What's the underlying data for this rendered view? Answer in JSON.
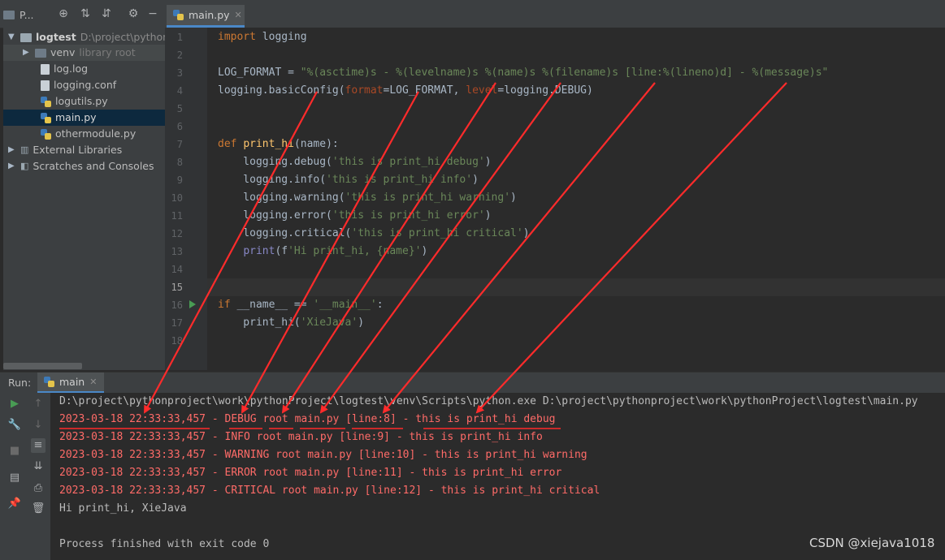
{
  "toolbar": {
    "project_tab_label": "P...",
    "editor_tab_label": "main.py"
  },
  "project": {
    "root_label": "logtest",
    "root_path": "D:\\project\\pythonp",
    "items": [
      {
        "label": "venv",
        "suffix": "library root"
      },
      {
        "label": "log.log"
      },
      {
        "label": "logging.conf"
      },
      {
        "label": "logutils.py"
      },
      {
        "label": "main.py"
      },
      {
        "label": "othermodule.py"
      },
      {
        "label": "External Libraries"
      },
      {
        "label": "Scratches and Consoles"
      }
    ]
  },
  "editor": {
    "line_numbers": [
      "1",
      "2",
      "3",
      "4",
      "5",
      "6",
      "7",
      "8",
      "9",
      "10",
      "11",
      "12",
      "13",
      "14",
      "15",
      "16",
      "17",
      "18"
    ],
    "lines": [
      "import logging",
      "",
      "LOG_FORMAT = \"%(asctime)s - %(levelname)s %(name)s %(filename)s [line:%(lineno)d] - %(message)s\"",
      "logging.basicConfig(format=LOG_FORMAT, level=logging.DEBUG)",
      "",
      "",
      "def print_hi(name):",
      "    logging.debug('this is print_hi debug')",
      "    logging.info('this is print_hi info')",
      "    logging.warning('this is print_hi warning')",
      "    logging.error('this is print_hi error')",
      "    logging.critical('this is print_hi critical')",
      "    print(f'Hi print_hi, {name}')",
      "",
      "",
      "if __name__ == '__main__':",
      "    print_hi('XieJava')",
      ""
    ]
  },
  "run": {
    "label": "Run:",
    "tab_label": "main",
    "console_lines": [
      {
        "text": "D:\\project\\pythonproject\\work\\pythonProject\\logtest\\venv\\Scripts\\python.exe D:\\project\\pythonproject\\work\\pythonProject\\logtest\\main.py",
        "kind": "gray"
      },
      {
        "text": "2023-03-18 22:33:33,457 - DEBUG root main.py [line:8] - this is print_hi debug",
        "kind": "red"
      },
      {
        "text": "2023-03-18 22:33:33,457 - INFO root main.py [line:9] - this is print_hi info",
        "kind": "red"
      },
      {
        "text": "2023-03-18 22:33:33,457 - WARNING root main.py [line:10] - this is print_hi warning",
        "kind": "red"
      },
      {
        "text": "2023-03-18 22:33:33,457 - ERROR root main.py [line:11] - this is print_hi error",
        "kind": "red"
      },
      {
        "text": "2023-03-18 22:33:33,457 - CRITICAL root main.py [line:12] - this is print_hi critical",
        "kind": "red"
      },
      {
        "text": "Hi print_hi, XieJava",
        "kind": "gray"
      },
      {
        "text": "",
        "kind": "gray"
      },
      {
        "text": "Process finished with exit code 0",
        "kind": "gray"
      }
    ]
  },
  "watermark": "CSDN @xiejava1018",
  "colors": {
    "accent": "#4a88c7",
    "annotation": "#ff2b2b",
    "console_error": "#ff6b68"
  }
}
